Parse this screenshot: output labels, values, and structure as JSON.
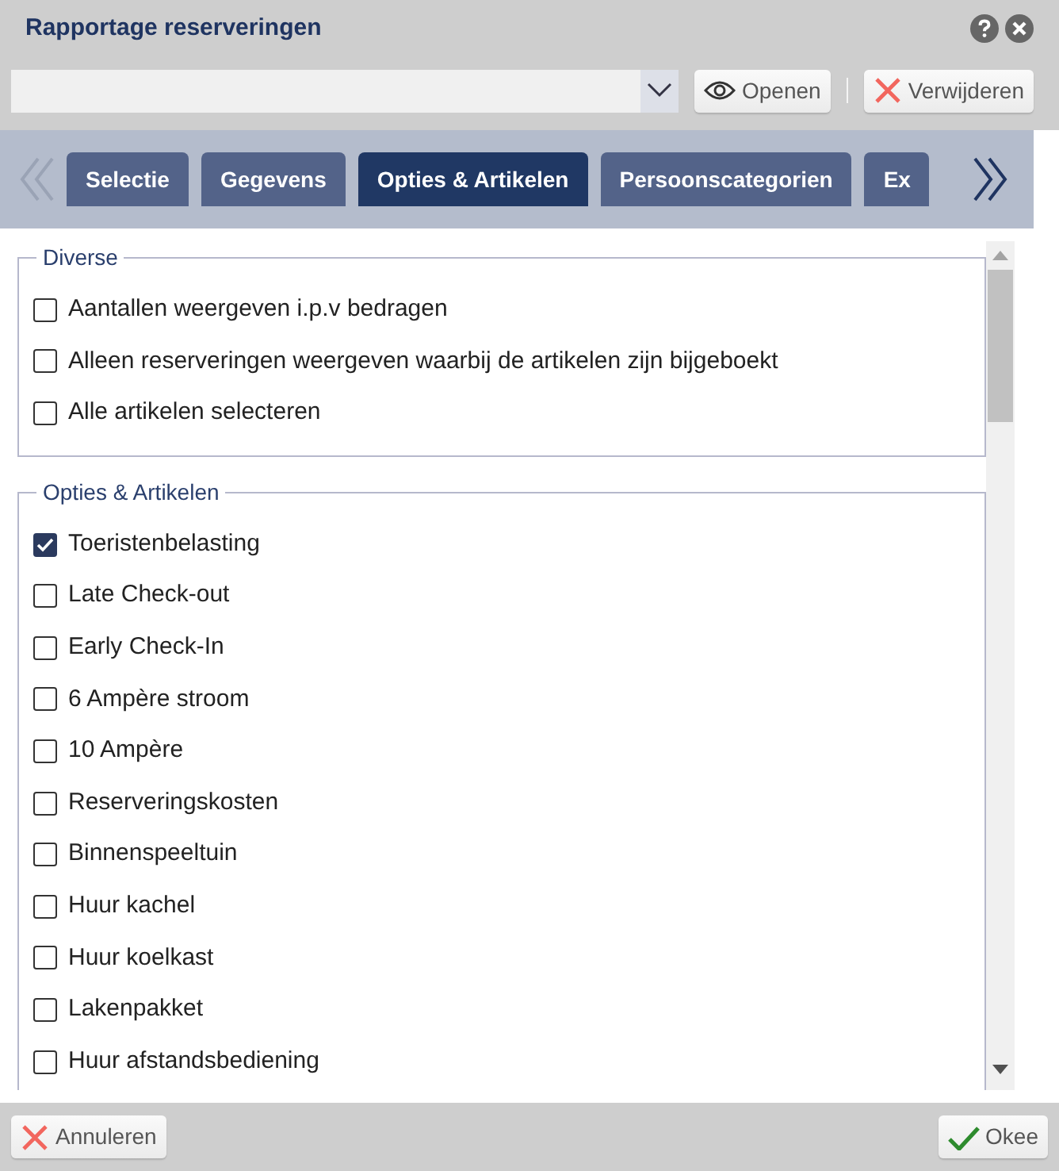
{
  "window": {
    "title": "Rapportage reserveringen"
  },
  "toolbar": {
    "buttons": [
      {
        "kind": "open",
        "label": "Openen"
      },
      {
        "kind": "delete",
        "label": "Verwijderen"
      }
    ]
  },
  "tabs": [
    {
      "label": "Selectie",
      "selected": false
    },
    {
      "label": "Gegevens",
      "selected": false
    },
    {
      "label": "Opties & Artikelen",
      "selected": true
    },
    {
      "label": "Persoonscategorien",
      "selected": false
    },
    {
      "label": "Ex",
      "selected": false
    }
  ],
  "groups": [
    {
      "title": "Diverse",
      "items": [
        {
          "label": "Aantallen weergeven i.p.v bedragen",
          "checked": false
        },
        {
          "label": "Alleen reserveringen weergeven waarbij de artikelen zijn bijgeboekt",
          "checked": false
        },
        {
          "label": "Alle artikelen selecteren",
          "checked": false
        }
      ]
    },
    {
      "title": "Opties & Artikelen",
      "items": [
        {
          "label": "Toeristenbelasting",
          "checked": true
        },
        {
          "label": "Late Check-out",
          "checked": false
        },
        {
          "label": "Early Check-In",
          "checked": false
        },
        {
          "label": "6 Ampère stroom",
          "checked": false
        },
        {
          "label": "10 Ampère",
          "checked": false
        },
        {
          "label": "Reserveringskosten",
          "checked": false
        },
        {
          "label": "Binnenspeeltuin",
          "checked": false
        },
        {
          "label": "Huur kachel",
          "checked": false
        },
        {
          "label": "Huur koelkast",
          "checked": false
        },
        {
          "label": "Lakenpakket",
          "checked": false
        },
        {
          "label": "Huur afstandsbediening",
          "checked": false
        }
      ]
    }
  ],
  "footer": {
    "buttons": [
      {
        "kind": "cancel",
        "label": "Annuleren"
      },
      {
        "kind": "ok",
        "label": "Okee"
      }
    ]
  }
}
